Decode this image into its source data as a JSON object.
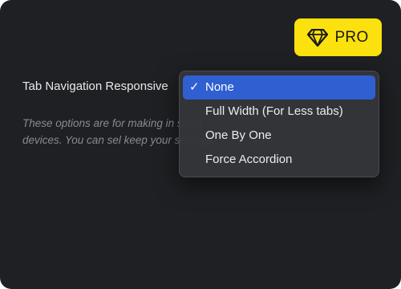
{
  "badge": {
    "label": "PRO",
    "icon": "diamond-icon",
    "color": "#fbe10d"
  },
  "setting": {
    "label": "Tab Navigation Responsive",
    "description": "These options are for making in small devices. You can sel keep your settings."
  },
  "dropdown": {
    "selected_index": 0,
    "check_glyph": "✓",
    "options": [
      {
        "label": "None"
      },
      {
        "label": "Full Width (For Less tabs)"
      },
      {
        "label": "One By One"
      },
      {
        "label": "Force Accordion"
      }
    ],
    "accent": "#2f5fd1"
  }
}
